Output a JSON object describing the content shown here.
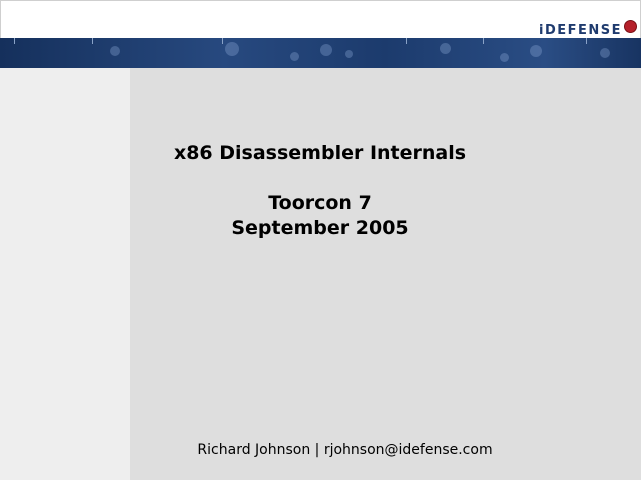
{
  "header": {
    "logo_text": "iDEFENSE"
  },
  "slide": {
    "title": "x86 Disassembler Internals",
    "event": "Toorcon 7",
    "date": "September 2005",
    "footer": "Richard Johnson  |  rjohnson@idefense.com"
  },
  "colors": {
    "banner": "#1f3b6e",
    "left_panel": "#eeeeee",
    "main_panel": "#dedede",
    "logo_text": "#1f3b6e",
    "logo_badge": "#b5202a"
  }
}
